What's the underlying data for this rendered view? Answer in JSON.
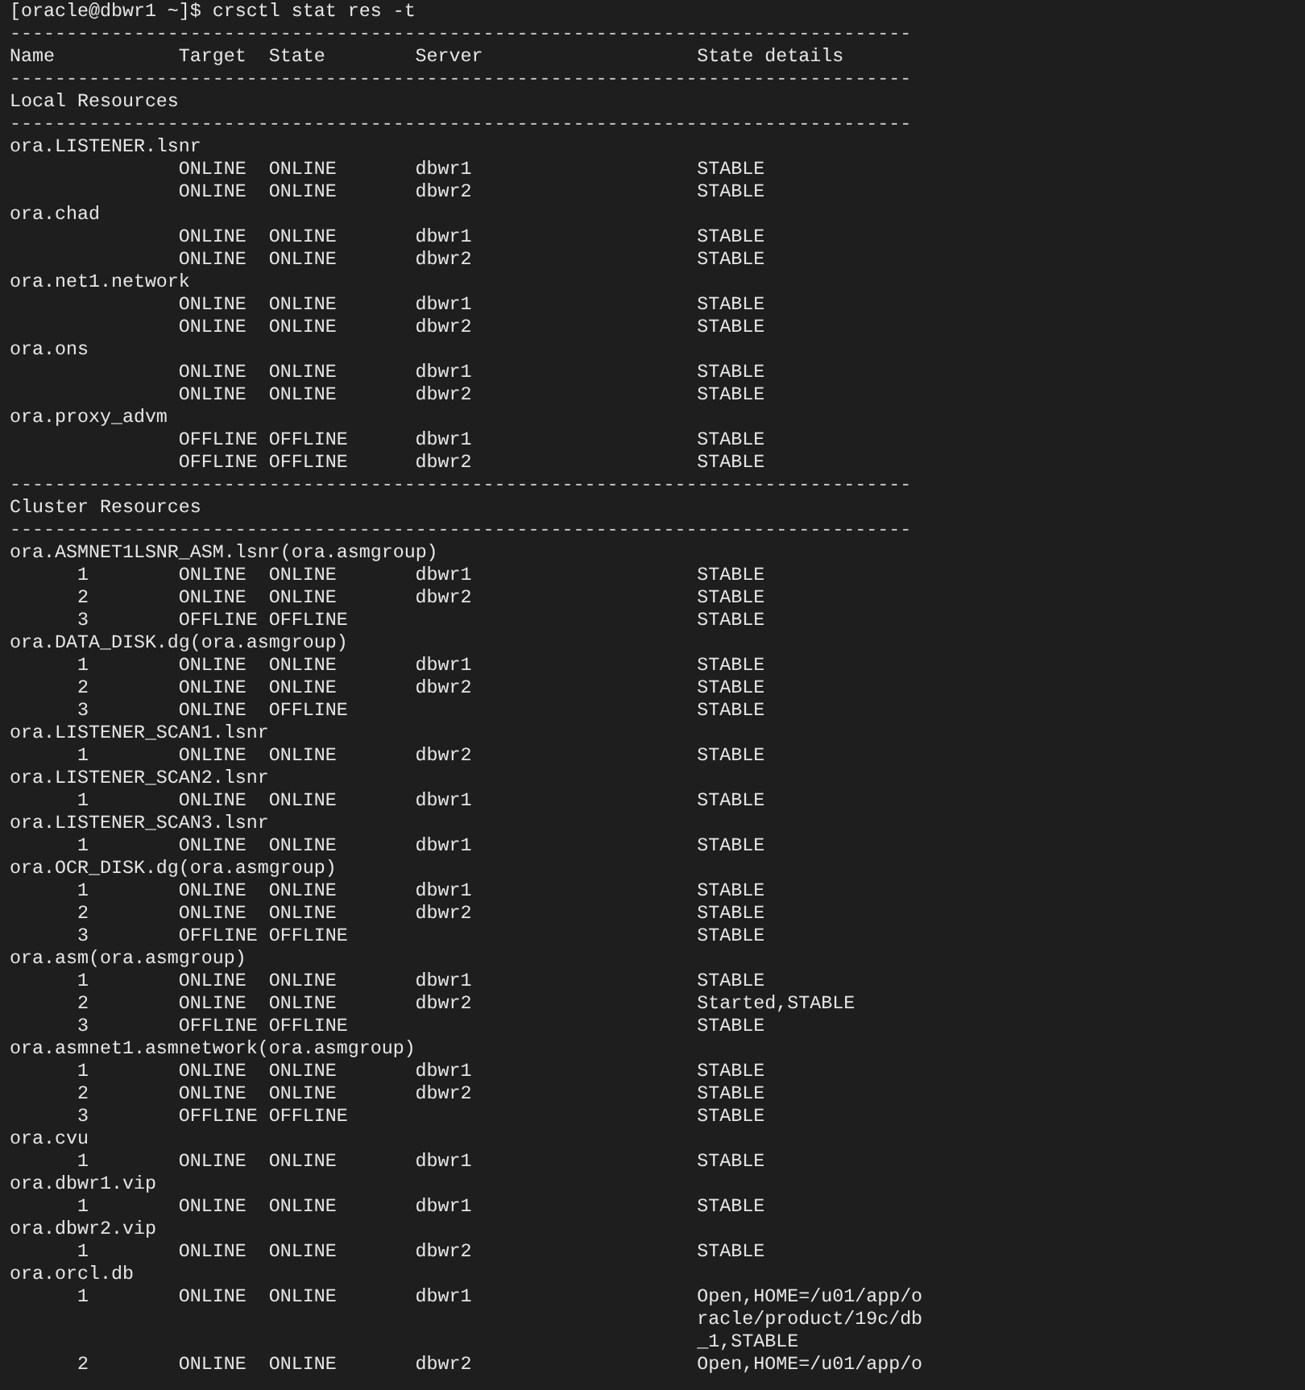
{
  "prompt": "[oracle@dbwr1 ~]$ crsctl stat res -t",
  "header_rule": "--------------------------------------------------------------------------------",
  "header": [
    "Name",
    "Target",
    "State",
    "Server",
    "State details"
  ],
  "sections": [
    {
      "rule_before": "--------------------------------------------------------------------------------",
      "title": "Local Resources",
      "rule_after": "--------------------------------------------------------------------------------",
      "resources": [
        {
          "name": "ora.LISTENER.lsnr",
          "rows": [
            {
              "target": "ONLINE",
              "state": "ONLINE",
              "server": "dbwr1",
              "details": [
                "STABLE"
              ]
            },
            {
              "target": "ONLINE",
              "state": "ONLINE",
              "server": "dbwr2",
              "details": [
                "STABLE"
              ]
            }
          ]
        },
        {
          "name": "ora.chad",
          "rows": [
            {
              "target": "ONLINE",
              "state": "ONLINE",
              "server": "dbwr1",
              "details": [
                "STABLE"
              ]
            },
            {
              "target": "ONLINE",
              "state": "ONLINE",
              "server": "dbwr2",
              "details": [
                "STABLE"
              ]
            }
          ]
        },
        {
          "name": "ora.net1.network",
          "rows": [
            {
              "target": "ONLINE",
              "state": "ONLINE",
              "server": "dbwr1",
              "details": [
                "STABLE"
              ]
            },
            {
              "target": "ONLINE",
              "state": "ONLINE",
              "server": "dbwr2",
              "details": [
                "STABLE"
              ]
            }
          ]
        },
        {
          "name": "ora.ons",
          "rows": [
            {
              "target": "ONLINE",
              "state": "ONLINE",
              "server": "dbwr1",
              "details": [
                "STABLE"
              ]
            },
            {
              "target": "ONLINE",
              "state": "ONLINE",
              "server": "dbwr2",
              "details": [
                "STABLE"
              ]
            }
          ]
        },
        {
          "name": "ora.proxy_advm",
          "rows": [
            {
              "target": "OFFLINE",
              "state": "OFFLINE",
              "server": "dbwr1",
              "details": [
                "STABLE"
              ]
            },
            {
              "target": "OFFLINE",
              "state": "OFFLINE",
              "server": "dbwr2",
              "details": [
                "STABLE"
              ]
            }
          ]
        }
      ]
    },
    {
      "rule_before": "--------------------------------------------------------------------------------",
      "title": "Cluster Resources",
      "rule_after": "--------------------------------------------------------------------------------",
      "resources": [
        {
          "name": "ora.ASMNET1LSNR_ASM.lsnr(ora.asmgroup)",
          "rows": [
            {
              "instance": "1",
              "target": "ONLINE",
              "state": "ONLINE",
              "server": "dbwr1",
              "details": [
                "STABLE"
              ]
            },
            {
              "instance": "2",
              "target": "ONLINE",
              "state": "ONLINE",
              "server": "dbwr2",
              "details": [
                "STABLE"
              ]
            },
            {
              "instance": "3",
              "target": "OFFLINE",
              "state": "OFFLINE",
              "details": [
                "STABLE"
              ]
            }
          ]
        },
        {
          "name": "ora.DATA_DISK.dg(ora.asmgroup)",
          "rows": [
            {
              "instance": "1",
              "target": "ONLINE",
              "state": "ONLINE",
              "server": "dbwr1",
              "details": [
                "STABLE"
              ]
            },
            {
              "instance": "2",
              "target": "ONLINE",
              "state": "ONLINE",
              "server": "dbwr2",
              "details": [
                "STABLE"
              ]
            },
            {
              "instance": "3",
              "target": "ONLINE",
              "state": "OFFLINE",
              "details": [
                "STABLE"
              ]
            }
          ]
        },
        {
          "name": "ora.LISTENER_SCAN1.lsnr",
          "rows": [
            {
              "instance": "1",
              "target": "ONLINE",
              "state": "ONLINE",
              "server": "dbwr2",
              "details": [
                "STABLE"
              ]
            }
          ]
        },
        {
          "name": "ora.LISTENER_SCAN2.lsnr",
          "rows": [
            {
              "instance": "1",
              "target": "ONLINE",
              "state": "ONLINE",
              "server": "dbwr1",
              "details": [
                "STABLE"
              ]
            }
          ]
        },
        {
          "name": "ora.LISTENER_SCAN3.lsnr",
          "rows": [
            {
              "instance": "1",
              "target": "ONLINE",
              "state": "ONLINE",
              "server": "dbwr1",
              "details": [
                "STABLE"
              ]
            }
          ]
        },
        {
          "name": "ora.OCR_DISK.dg(ora.asmgroup)",
          "rows": [
            {
              "instance": "1",
              "target": "ONLINE",
              "state": "ONLINE",
              "server": "dbwr1",
              "details": [
                "STABLE"
              ]
            },
            {
              "instance": "2",
              "target": "ONLINE",
              "state": "ONLINE",
              "server": "dbwr2",
              "details": [
                "STABLE"
              ]
            },
            {
              "instance": "3",
              "target": "OFFLINE",
              "state": "OFFLINE",
              "details": [
                "STABLE"
              ]
            }
          ]
        },
        {
          "name": "ora.asm(ora.asmgroup)",
          "rows": [
            {
              "instance": "1",
              "target": "ONLINE",
              "state": "ONLINE",
              "server": "dbwr1",
              "details": [
                "STABLE"
              ]
            },
            {
              "instance": "2",
              "target": "ONLINE",
              "state": "ONLINE",
              "server": "dbwr2",
              "details": [
                "Started,STABLE"
              ]
            },
            {
              "instance": "3",
              "target": "OFFLINE",
              "state": "OFFLINE",
              "details": [
                "STABLE"
              ]
            }
          ]
        },
        {
          "name": "ora.asmnet1.asmnetwork(ora.asmgroup)",
          "rows": [
            {
              "instance": "1",
              "target": "ONLINE",
              "state": "ONLINE",
              "server": "dbwr1",
              "details": [
                "STABLE"
              ]
            },
            {
              "instance": "2",
              "target": "ONLINE",
              "state": "ONLINE",
              "server": "dbwr2",
              "details": [
                "STABLE"
              ]
            },
            {
              "instance": "3",
              "target": "OFFLINE",
              "state": "OFFLINE",
              "details": [
                "STABLE"
              ]
            }
          ]
        },
        {
          "name": "ora.cvu",
          "rows": [
            {
              "instance": "1",
              "target": "ONLINE",
              "state": "ONLINE",
              "server": "dbwr1",
              "details": [
                "STABLE"
              ]
            }
          ]
        },
        {
          "name": "ora.dbwr1.vip",
          "rows": [
            {
              "instance": "1",
              "target": "ONLINE",
              "state": "ONLINE",
              "server": "dbwr1",
              "details": [
                "STABLE"
              ]
            }
          ]
        },
        {
          "name": "ora.dbwr2.vip",
          "rows": [
            {
              "instance": "1",
              "target": "ONLINE",
              "state": "ONLINE",
              "server": "dbwr2",
              "details": [
                "STABLE"
              ]
            }
          ]
        },
        {
          "name": "ora.orcl.db",
          "rows": [
            {
              "instance": "1",
              "target": "ONLINE",
              "state": "ONLINE",
              "server": "dbwr1",
              "details": [
                "Open,HOME=/u01/app/o",
                "racle/product/19c/db",
                "_1,STABLE"
              ]
            },
            {
              "instance": "2",
              "target": "ONLINE",
              "state": "ONLINE",
              "server": "dbwr2",
              "details": [
                "Open,HOME=/u01/app/o"
              ]
            }
          ]
        }
      ]
    }
  ]
}
